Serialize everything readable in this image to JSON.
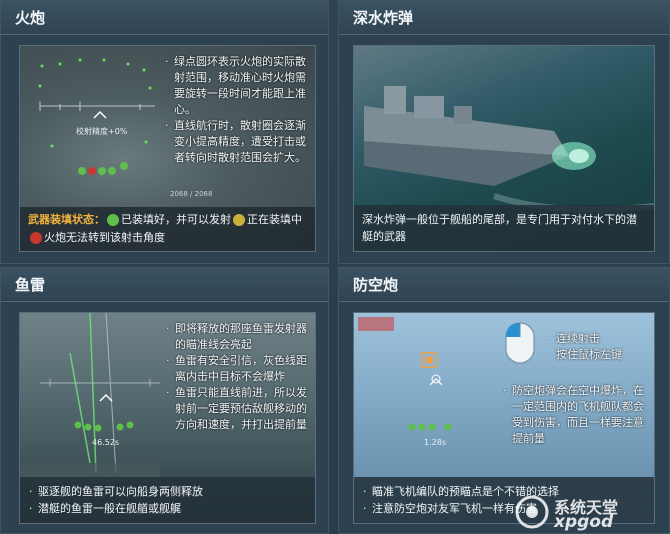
{
  "panels": {
    "cannon": {
      "title": "火炮",
      "hud_text": "校射精度+0%",
      "hud_text2": "2068 / 2068",
      "notes": [
        "绿点圆环表示火炮的实际散射范围，移动准心时火炮需要旋转一段时间才能跟上准心。",
        "直线航行时，散射圈会逐渐变小提高精度，遭受打击或者转向时散射范围会扩大。"
      ],
      "status_label": "武器装填状态：",
      "status_loaded": "已装填好，并可以发射",
      "status_loading": "正在装填中",
      "status_blocked": "火炮无法转到该射击角度",
      "colors": {
        "loaded": "#5fbf4a",
        "loading": "#c9b23a",
        "blocked": "#c8372d"
      }
    },
    "depth_charge": {
      "title": "深水炸弹",
      "caption": "深水炸弹一般位于舰船的尾部，是专门用于对付水下的潜艇的武器"
    },
    "torpedo": {
      "title": "鱼雷",
      "hud_time": "46.52s",
      "notes": [
        "即将释放的那座鱼雷发射器的瞄准线会亮起",
        "鱼雷有安全引信，灰色线距离内击中目标不会爆炸",
        "鱼雷只能直线前进，所以发射前一定要预估敌舰移动的方向和速度，并打出提前量"
      ],
      "captions": [
        "驱逐舰的鱼雷可以向船身两侧释放",
        "潜艇的鱼雷一般在舰艏或舰艉"
      ]
    },
    "aa": {
      "title": "防空炮",
      "hud_time": "1.28s",
      "mouse_note_1": "连续射击",
      "mouse_note_2": "按住鼠标左键",
      "note": "防空炮弹会在空中爆炸，在一定范围内的飞机舰队都会受到伤害，而且一样要注意提前量",
      "captions": [
        "瞄准飞机编队的预瞄点是个不错的选择",
        "注意防空炮对友军飞机一样有伤害"
      ]
    }
  },
  "watermark": {
    "text": "系统天堂",
    "sub": "xpgod"
  }
}
